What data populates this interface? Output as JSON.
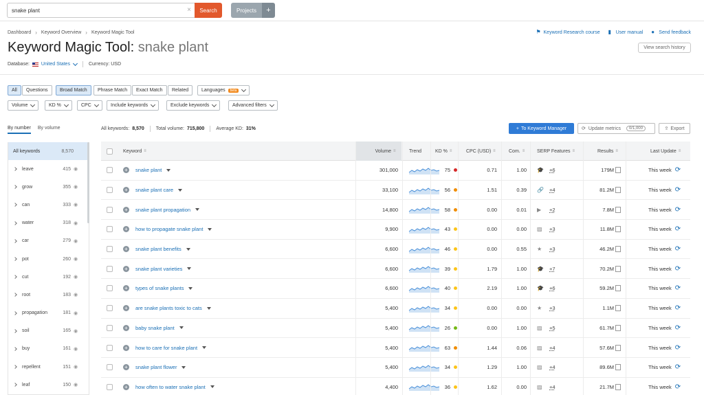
{
  "search": {
    "value": "snake plant",
    "button": "Search"
  },
  "projects": {
    "label": "Projects",
    "plus": "+"
  },
  "breadcrumb": [
    "Dashboard",
    "Keyword Overview",
    "Keyword Magic Tool"
  ],
  "links": [
    "Keyword Research course",
    "User manual",
    "Send feedback"
  ],
  "title": {
    "tool": "Keyword Magic Tool:",
    "query": "snake plant"
  },
  "history_button": "View search history",
  "database": {
    "label": "Database:",
    "country": "United States",
    "currency": "Currency: USD"
  },
  "match_tabs": [
    "All",
    "Questions",
    "Broad Match",
    "Phrase Match",
    "Exact Match",
    "Related"
  ],
  "languages": {
    "label": "Languages",
    "badge": "beta"
  },
  "filters": [
    "Volume",
    "KD %",
    "CPC",
    "Include keywords",
    "Exclude keywords",
    "Advanced filters"
  ],
  "side_tabs": [
    "By number",
    "By volume"
  ],
  "sidebar": {
    "all_label": "All keywords",
    "all_count": "8,570",
    "groups": [
      {
        "word": "leave",
        "count": "415"
      },
      {
        "word": "grow",
        "count": "355"
      },
      {
        "word": "can",
        "count": "333"
      },
      {
        "word": "water",
        "count": "318"
      },
      {
        "word": "car",
        "count": "279"
      },
      {
        "word": "pot",
        "count": "260"
      },
      {
        "word": "cut",
        "count": "192"
      },
      {
        "word": "root",
        "count": "183"
      },
      {
        "word": "propagation",
        "count": "181"
      },
      {
        "word": "soil",
        "count": "165"
      },
      {
        "word": "buy",
        "count": "161"
      },
      {
        "word": "repellent",
        "count": "151"
      },
      {
        "word": "leaf",
        "count": "150"
      }
    ]
  },
  "stats": {
    "all_label": "All keywords:",
    "all_value": "8,570",
    "volume_label": "Total volume:",
    "volume_value": "715,800",
    "kd_label": "Average KD:",
    "kd_value": "31%"
  },
  "actions": {
    "to_manager": "To Keyword Manager",
    "update": "Update metrics",
    "update_count": "0/1,000",
    "export": "Export"
  },
  "columns": [
    "Keyword",
    "Volume",
    "Trend",
    "KD %",
    "CPC (USD)",
    "Com.",
    "SERP Features",
    "Results",
    "Last Update"
  ],
  "colors": {
    "kd_red": "#e03131",
    "kd_orange": "#f08c00",
    "kd_yellow": "#fcc419",
    "kd_green": "#74b816",
    "accent": "#2f7bd6"
  },
  "rows": [
    {
      "kw": "snake plant",
      "vol": "301,000",
      "kd": "75",
      "kdc": "#d62828",
      "cpc": "0.71",
      "com": "1.00",
      "serp": "grad-cap-icon",
      "ico": "🎓",
      "more": "+6",
      "res": "179M",
      "upd": "This week"
    },
    {
      "kw": "snake plant care",
      "vol": "33,100",
      "kd": "56",
      "kdc": "#f08c00",
      "cpc": "1.51",
      "com": "0.39",
      "serp": "link-icon",
      "ico": "🔗",
      "more": "+4",
      "res": "81.2M",
      "upd": "This week"
    },
    {
      "kw": "snake plant propagation",
      "vol": "14,800",
      "kd": "58",
      "kdc": "#f08c00",
      "cpc": "0.00",
      "com": "0.01",
      "serp": "video-icon",
      "ico": "▶",
      "more": "+2",
      "res": "7.8M",
      "upd": "This week"
    },
    {
      "kw": "how to propagate snake plant",
      "vol": "9,900",
      "kd": "43",
      "kdc": "#fcc419",
      "cpc": "0.00",
      "com": "0.00",
      "serp": "image-icon",
      "ico": "▨",
      "more": "+3",
      "res": "11.8M",
      "upd": "This week"
    },
    {
      "kw": "snake plant benefits",
      "vol": "6,600",
      "kd": "46",
      "kdc": "#fcc419",
      "cpc": "0.00",
      "com": "0.55",
      "serp": "star-icon",
      "ico": "★",
      "more": "+3",
      "res": "46.2M",
      "upd": "This week"
    },
    {
      "kw": "snake plant varieties",
      "vol": "6,600",
      "kd": "39",
      "kdc": "#fcc419",
      "cpc": "1.79",
      "com": "1.00",
      "serp": "grad-cap-icon",
      "ico": "🎓",
      "more": "+7",
      "res": "70.2M",
      "upd": "This week"
    },
    {
      "kw": "types of snake plants",
      "vol": "6,600",
      "kd": "40",
      "kdc": "#fcc419",
      "cpc": "2.19",
      "com": "1.00",
      "serp": "grad-cap-icon",
      "ico": "🎓",
      "more": "+6",
      "res": "59.2M",
      "upd": "This week"
    },
    {
      "kw": "are snake plants toxic to cats",
      "vol": "5,400",
      "kd": "34",
      "kdc": "#fcc419",
      "cpc": "0.00",
      "com": "0.00",
      "serp": "star-icon",
      "ico": "★",
      "more": "+3",
      "res": "1.1M",
      "upd": "This week"
    },
    {
      "kw": "baby snake plant",
      "vol": "5,400",
      "kd": "26",
      "kdc": "#74b816",
      "cpc": "0.00",
      "com": "1.00",
      "serp": "image-icon",
      "ico": "▨",
      "more": "+5",
      "res": "61.7M",
      "upd": "This week"
    },
    {
      "kw": "how to care for snake plant",
      "vol": "5,400",
      "kd": "63",
      "kdc": "#f08c00",
      "cpc": "1.44",
      "com": "0.06",
      "serp": "image-icon",
      "ico": "▨",
      "more": "+4",
      "res": "57.6M",
      "upd": "This week"
    },
    {
      "kw": "snake plant flower",
      "vol": "5,400",
      "kd": "34",
      "kdc": "#fcc419",
      "cpc": "1.29",
      "com": "1.00",
      "serp": "image-icon",
      "ico": "▨",
      "more": "+4",
      "res": "89.6M",
      "upd": "This week"
    },
    {
      "kw": "how often to water snake plant",
      "vol": "4,400",
      "kd": "36",
      "kdc": "#fcc419",
      "cpc": "1.62",
      "com": "0.00",
      "serp": "image-icon",
      "ico": "▨",
      "more": "+4",
      "res": "21.7M",
      "upd": "This week"
    }
  ]
}
